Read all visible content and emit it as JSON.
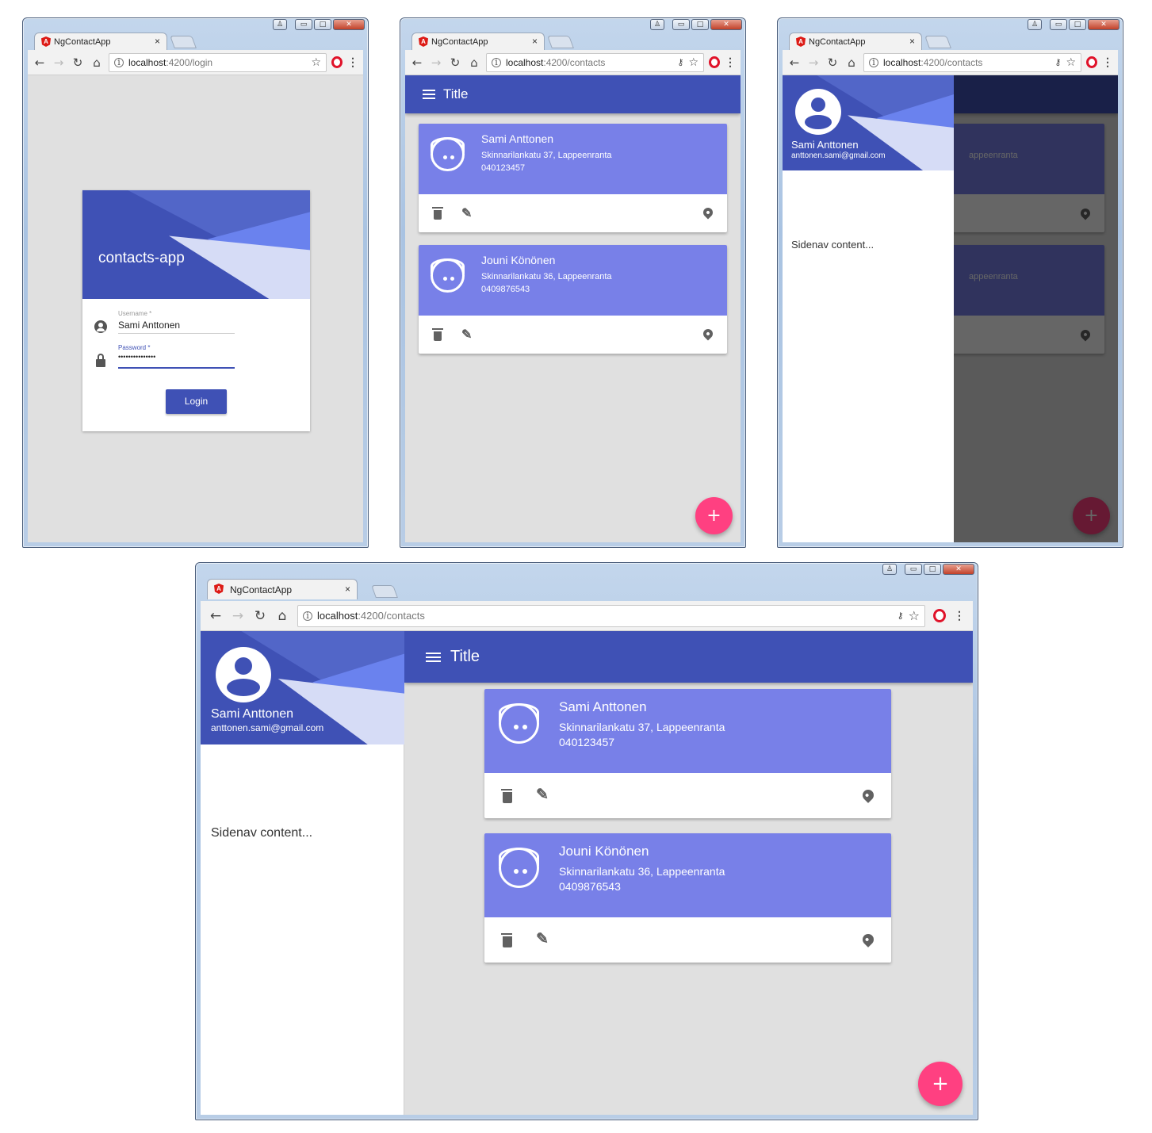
{
  "browser": {
    "tab_title": "NgContactApp",
    "tab_close": "×",
    "url_host": "localhost",
    "url_login_path": ":4200/login",
    "url_contacts_path": ":4200/contacts",
    "window_buttons": {
      "minimize": "▭",
      "maximize": "□",
      "close": "✕"
    }
  },
  "login": {
    "app_title": "contacts-app",
    "username_label": "Username *",
    "username_value": "Sami Anttonen",
    "password_label": "Password *",
    "password_value": "•••••••••••••••",
    "login_button": "Login"
  },
  "toolbar": {
    "title": "Title"
  },
  "contacts": [
    {
      "name": "Sami Anttonen",
      "address": "Skinnarilankatu 37, Lappeenranta",
      "phone": "040123457"
    },
    {
      "name": "Jouni Könönen",
      "address": "Skinnarilankatu 36, Lappeenranta",
      "phone": "0409876543"
    }
  ],
  "sidenav": {
    "user_name": "Sami Anttonen",
    "user_email": "anttonen.sami@gmail.com",
    "content": "Sidenav content..."
  },
  "overlay_partial_address": "appeenranta",
  "fab_label": "+",
  "colors": {
    "primary": "#3f51b5",
    "card_header": "#7880e8",
    "accent": "#ff4081",
    "background": "#e0e0e0"
  },
  "icons": [
    "back-icon",
    "forward-icon",
    "reload-icon",
    "home-icon",
    "info-icon",
    "key-icon",
    "star-icon",
    "opera-icon",
    "menu-dots-icon",
    "menu-icon",
    "face-icon",
    "delete-icon",
    "edit-icon",
    "location-icon",
    "account-icon",
    "lock-icon",
    "add-icon"
  ]
}
